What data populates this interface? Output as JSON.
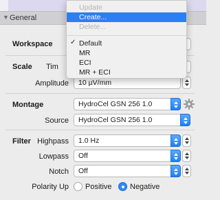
{
  "section": {
    "title": "General"
  },
  "workspace": {
    "label": "Workspace",
    "menu": {
      "items": [
        {
          "label": "Update",
          "enabled": false
        },
        {
          "label": "Create...",
          "enabled": true,
          "highlighted": true
        },
        {
          "label": "Delete...",
          "enabled": false
        }
      ],
      "layouts": [
        {
          "label": "Default",
          "checked": true
        },
        {
          "label": "MR",
          "checked": false
        },
        {
          "label": "ECI",
          "checked": false
        },
        {
          "label": "MR + ECI",
          "checked": false
        }
      ]
    }
  },
  "scale": {
    "label": "Scale",
    "time_label": "Tim",
    "amplitude_label": "Amplitude",
    "amplitude_value": "10 µV/mm"
  },
  "montage": {
    "label": "Montage",
    "value": "HydroCel GSN 256 1.0",
    "source_label": "Source",
    "source_value": "HydroCel GSN 256 1.0"
  },
  "filter": {
    "label": "Filter",
    "highpass_label": "Highpass",
    "highpass_value": "1.0 Hz",
    "lowpass_label": "Lowpass",
    "lowpass_value": "Off",
    "notch_label": "Notch",
    "notch_value": "Off"
  },
  "polarity": {
    "label": "Polarity Up",
    "options": [
      {
        "label": "Positive",
        "selected": false
      },
      {
        "label": "Negative",
        "selected": true
      }
    ]
  },
  "colors": {
    "accent": "#2c7ef5",
    "section_bg": "#d0d0d4"
  }
}
